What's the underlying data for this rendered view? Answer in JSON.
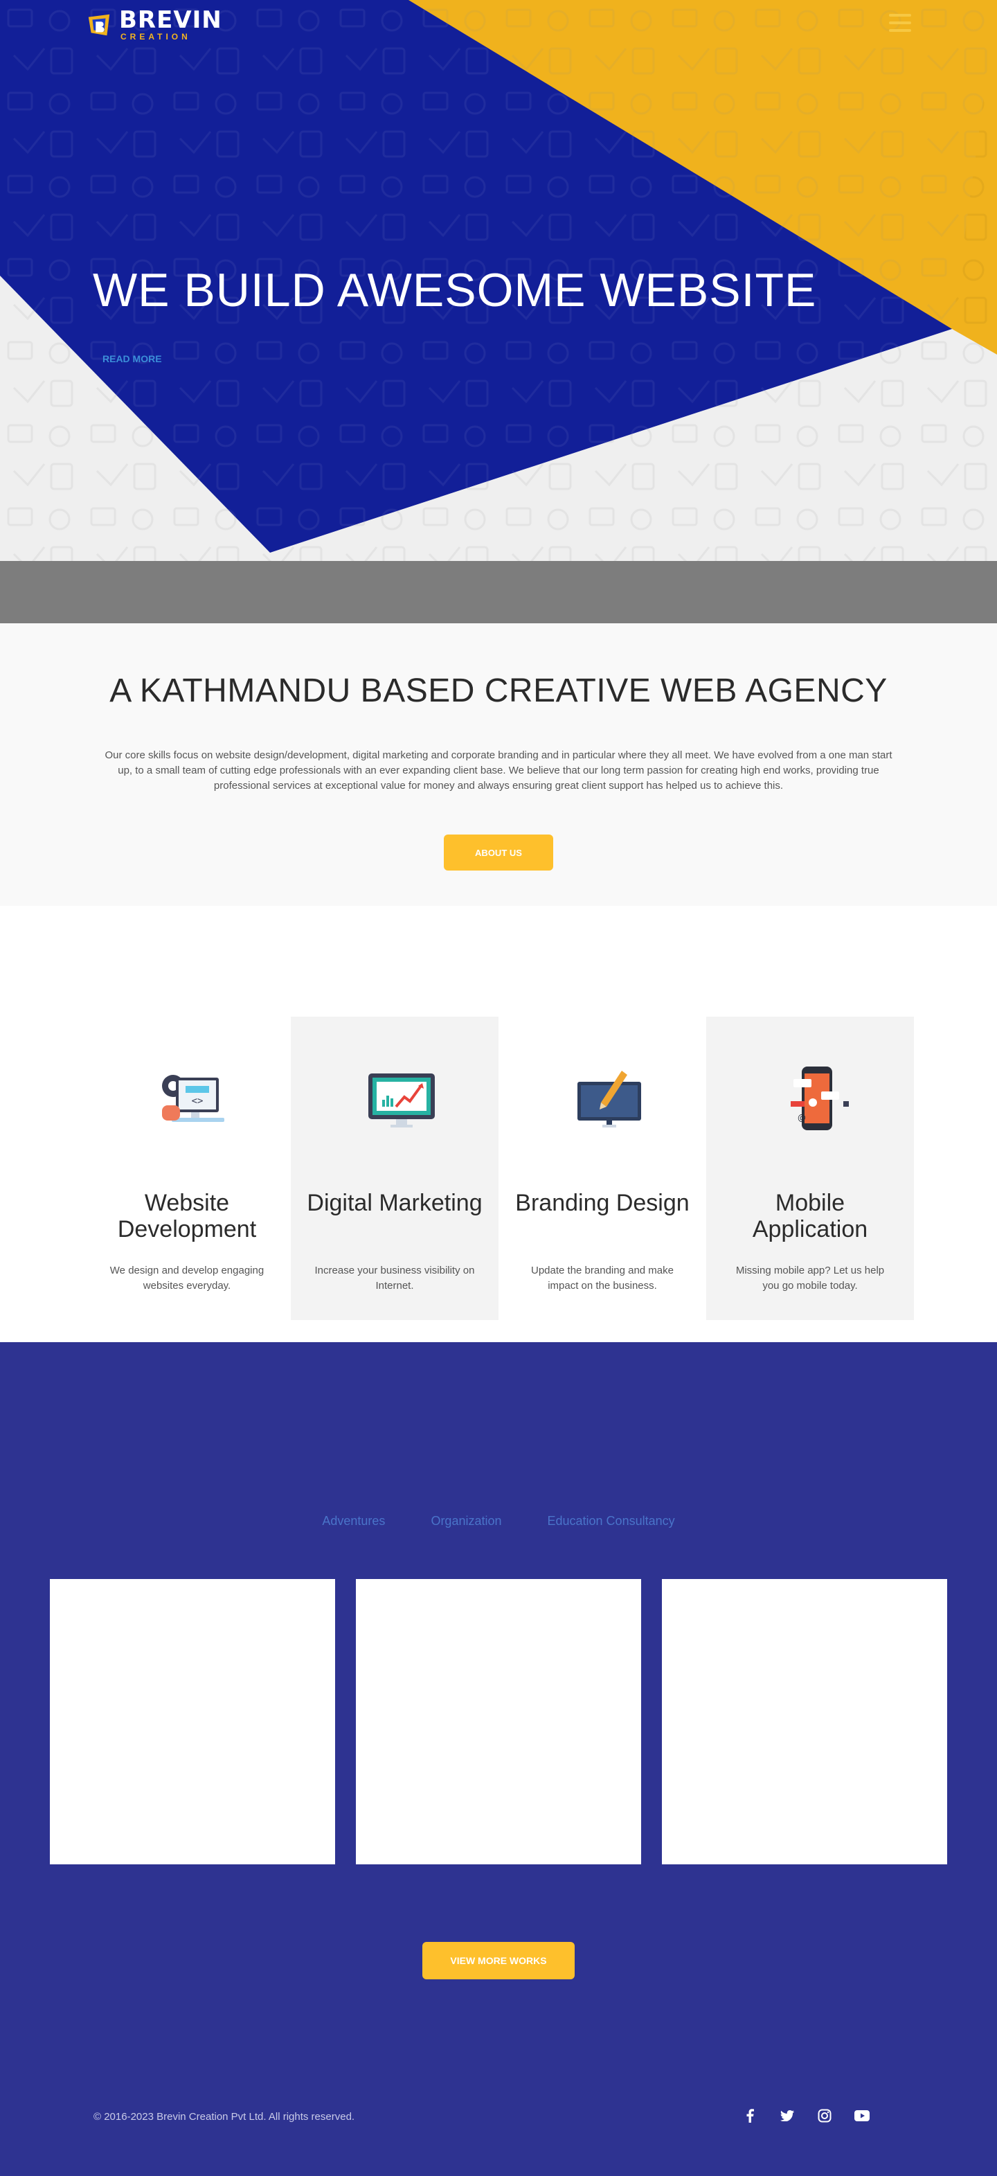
{
  "brand": {
    "name": "BREVIN",
    "tagline": "CREATION",
    "colors": {
      "blue": "#121f98",
      "yellow": "#f0b21d",
      "button": "#fec02c",
      "works_bg": "#2e3391"
    }
  },
  "header": {
    "menu_icon": "hamburger-icon"
  },
  "hero": {
    "title": "WE BUILD AWESOME WEBSITE",
    "read_more": "READ MORE"
  },
  "about": {
    "heading": "A KATHMANDU BASED CREATIVE WEB AGENCY",
    "text": "Our core skills focus on website design/development, digital marketing and corporate branding and in particular where they all meet. We have evolved from a one man start up, to a small team of cutting edge professionals with an ever expanding client base. We believe that our long term passion for creating high end works, providing true professional services at exceptional value for money and always ensuring great client support has helped us to achieve this.",
    "button": "ABOUT US"
  },
  "services": [
    {
      "title": "Website Development",
      "text": "We design and develop engaging websites everyday.",
      "icon": "web-development-icon"
    },
    {
      "title": "Digital Marketing",
      "text": "Increase your business visibility on Internet.",
      "icon": "digital-marketing-icon"
    },
    {
      "title": "Branding Design",
      "text": "Update the branding and make impact on the business.",
      "icon": "branding-design-icon"
    },
    {
      "title": "Mobile Application",
      "text": "Missing mobile app? Let us help you go mobile today.",
      "icon": "mobile-application-icon"
    }
  ],
  "works": {
    "filters": [
      "Adventures",
      "Organization",
      "Education Consultancy"
    ],
    "button": "VIEW MORE WORKS"
  },
  "footer": {
    "copyright": "© 2016-2023 Brevin Creation Pvt Ltd. All rights reserved.",
    "social": [
      "facebook-icon",
      "twitter-icon",
      "instagram-icon",
      "youtube-icon"
    ]
  }
}
